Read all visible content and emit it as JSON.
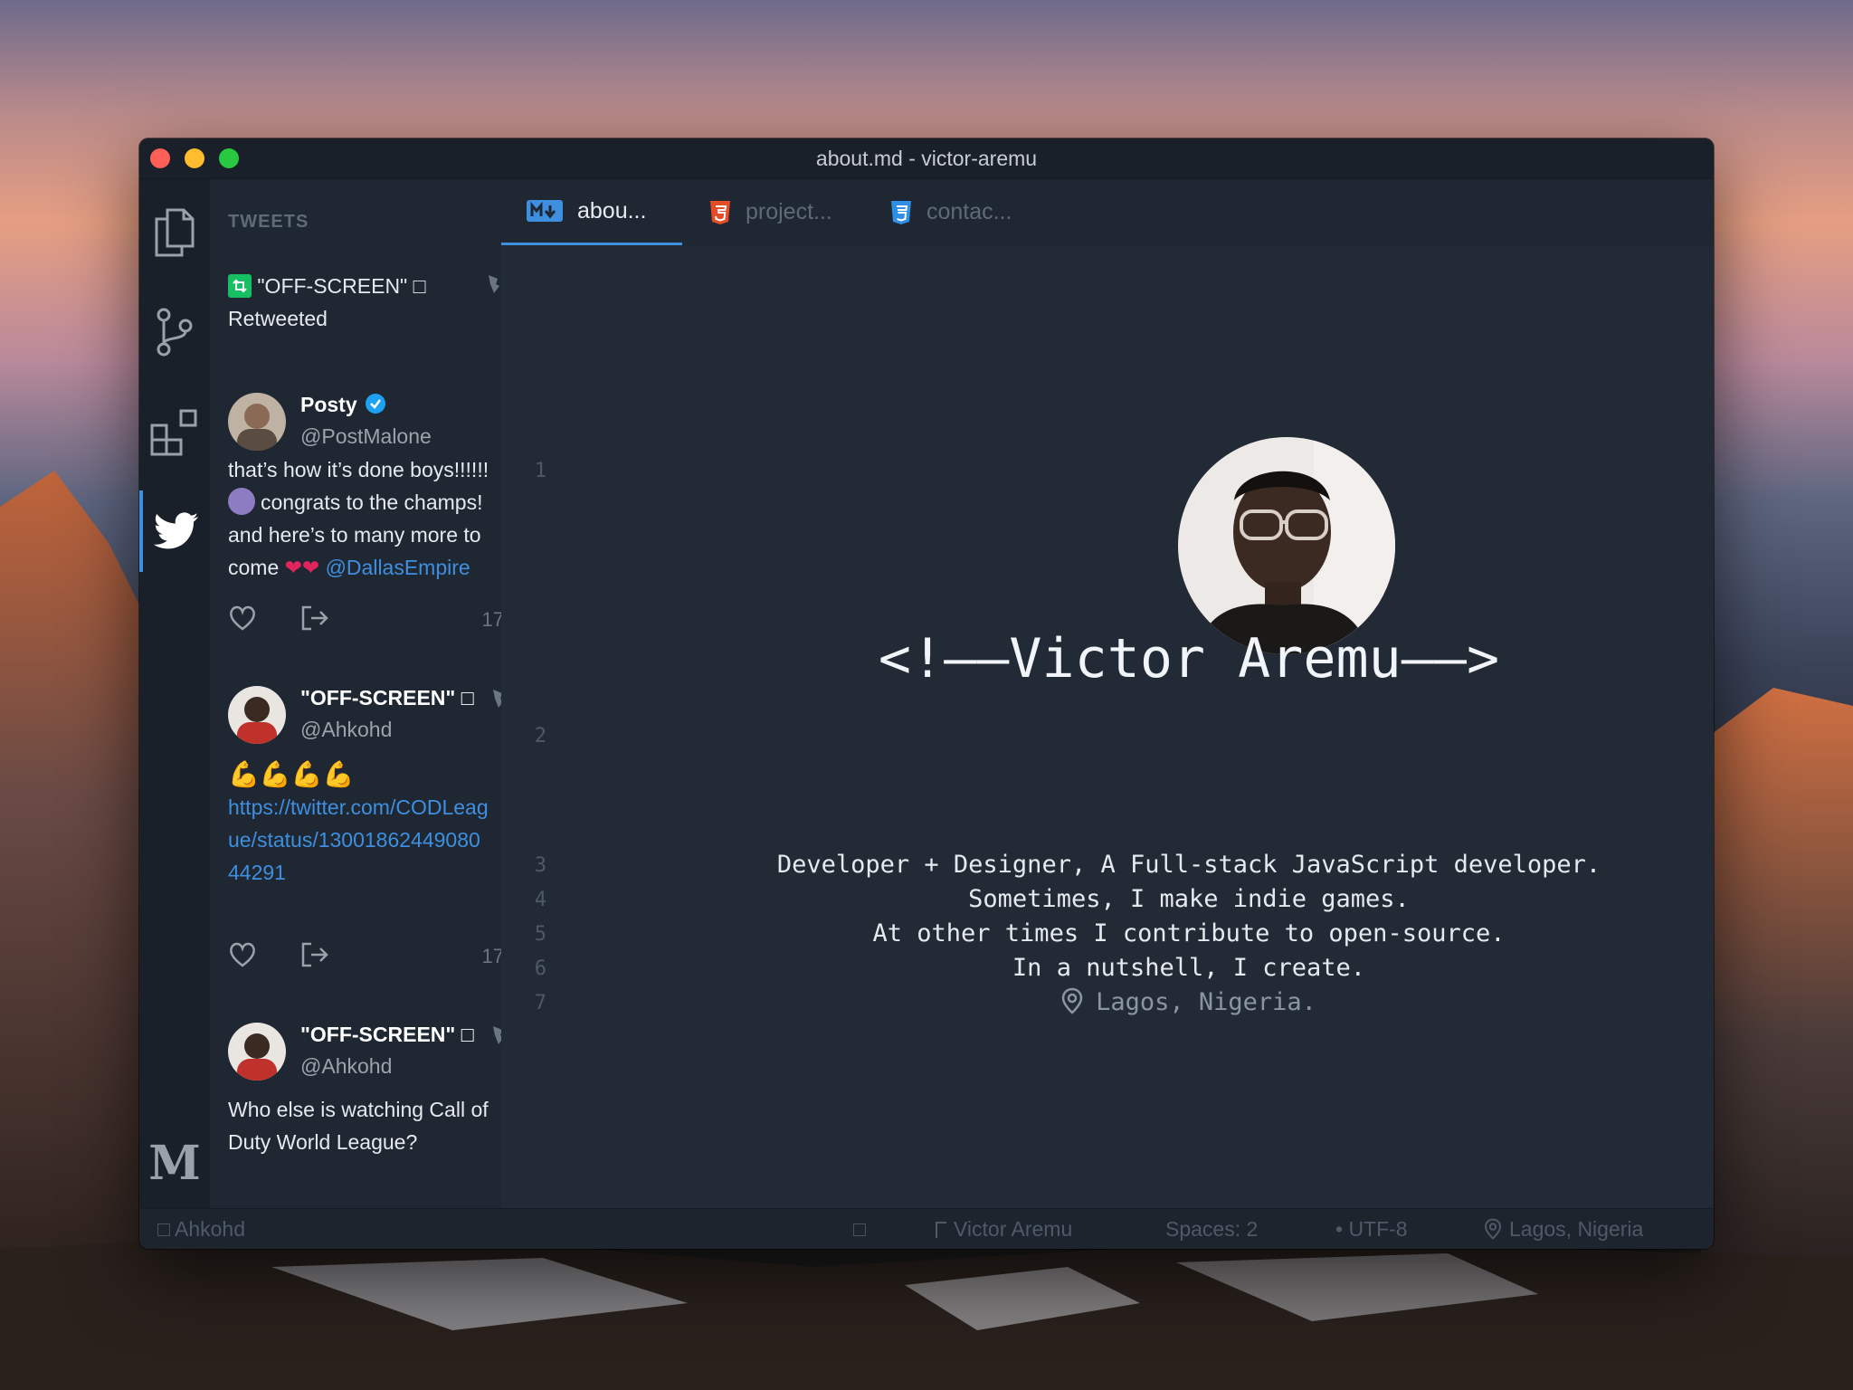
{
  "window": {
    "title": "about.md - victor-aremu"
  },
  "sidebar": {
    "header": "TWEETS",
    "tweets": [
      {
        "retweet_by": "\"OFF-SCREEN\" □",
        "retweet_label": "Retweeted",
        "name": "Posty",
        "handle": "@PostMalone",
        "lines": [
          "that’s how it’s done boys!!!!!!",
          "congrats to the champs!",
          "and here’s to many more to",
          "come"
        ],
        "mention": "@DallasEmpire",
        "count": "17"
      },
      {
        "name": "\"OFF-SCREEN\" □",
        "handle": "@Ahkohd",
        "emoji": "💪💪💪💪",
        "link_lines": [
          "https://twitter.com/CODLeag",
          "ue/status/13001862449080",
          "44291"
        ],
        "count": "17"
      },
      {
        "name": "\"OFF-SCREEN\" □",
        "handle": "@Ahkohd",
        "lines": [
          "Who else is watching Call of",
          "Duty World League?"
        ]
      }
    ]
  },
  "tabs": [
    {
      "label": "abou...",
      "icon": "markdown-icon",
      "color": "#3e8fe0"
    },
    {
      "label": "project...",
      "icon": "html5-icon",
      "color": "#e44d26"
    },
    {
      "label": "contac...",
      "icon": "css3-icon",
      "color": "#2d8fe6"
    }
  ],
  "line_numbers": [
    "1",
    "2",
    "3",
    "4",
    "5",
    "6",
    "7"
  ],
  "content": {
    "heading": "<!——Victor Aremu——>",
    "lines": [
      "Developer + Designer, A Full-stack JavaScript developer.",
      "Sometimes, I make indie games.",
      "At other times I contribute to open-source.",
      "In a nutshell, I create."
    ],
    "location": "Lagos, Nigeria."
  },
  "statusbar": {
    "user": "□ Ahkohd",
    "mid_glyph": "□",
    "branch": "Victor Aremu",
    "spaces": "Spaces: 2",
    "encoding": "• UTF-8",
    "location": "Lagos, Nigeria"
  },
  "colors": {
    "accent": "#3e8fe0",
    "editor_bg": "#222a35",
    "sidebar_bg": "#1f2732"
  }
}
